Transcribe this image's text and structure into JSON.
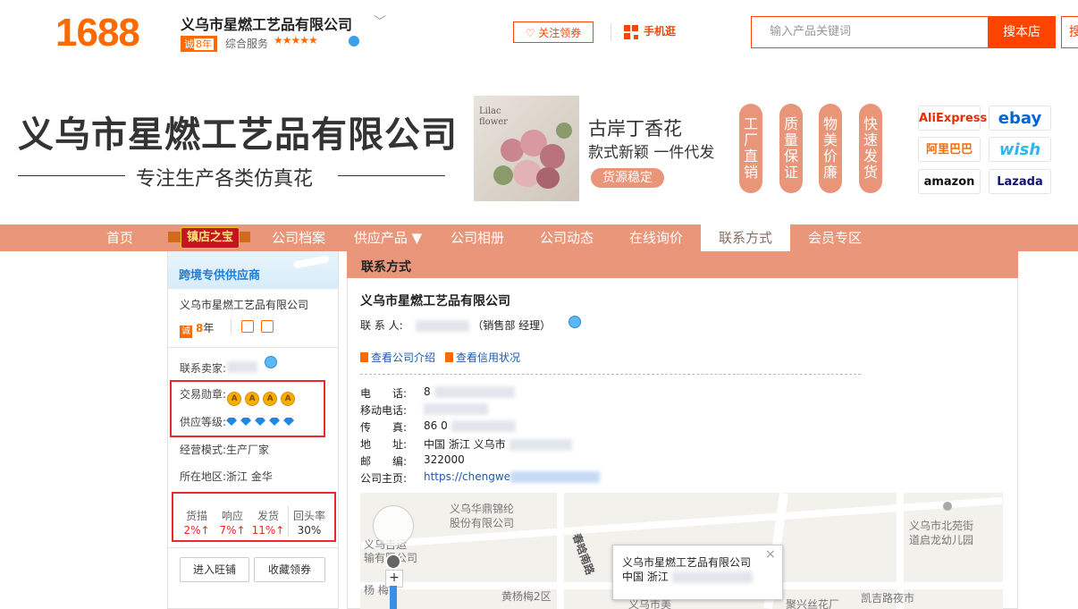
{
  "header": {
    "logo": "1688",
    "shop_name": "义乌市星燃工艺品有限公司",
    "year_badge_prefix": "诚",
    "year_badge_years": "8年",
    "service_label": "综合服务",
    "stars": "★★★★★",
    "follow_button": "关注领券",
    "mobile_label": "手机逛",
    "search_placeholder": "输入产品关键词",
    "search_button": "搜本店",
    "search_button_2": "搜"
  },
  "banner": {
    "company_name": "义乌市星燃工艺品有限公司",
    "slogan": "专注生产各类仿真花",
    "product_image_text": "Lilac flower",
    "product_title": "古岸丁香花",
    "product_subtitle": "款式新颖 一件代发",
    "product_tag": "货源稳定",
    "pills": [
      "工厂直销",
      "质量保证",
      "物美价廉",
      "快速发货"
    ],
    "platforms": [
      {
        "name": "AliExpress",
        "color": "#e62e04"
      },
      {
        "name": "ebay",
        "color": "#0064d2"
      },
      {
        "name": "阿里巴巴",
        "color": "#ff6a00"
      },
      {
        "name": "wish",
        "color": "#2fb7ec"
      },
      {
        "name": "amazon",
        "color": "#111111"
      },
      {
        "name": "Lazada",
        "color": "#0f136f"
      }
    ]
  },
  "nav": {
    "items": [
      "首页",
      "镇店之宝",
      "公司档案",
      "供应产品 ▼",
      "公司相册",
      "公司动态",
      "在线询价",
      "联系方式",
      "会员专区"
    ],
    "active": "联系方式"
  },
  "sidebar": {
    "header": "跨境专供供应商",
    "company": "义乌市星燃工艺品有限公司",
    "year_icon": "诚",
    "years_num": "8",
    "years_unit": "年",
    "contact_label": "联系卖家:",
    "medal_label": "交易勋章:",
    "medal_glyph": "A",
    "supply_label": "供应等级:",
    "business_mode": "经营模式:生产厂家",
    "region": "所在地区:浙江 金华",
    "stats": [
      {
        "label": "货描",
        "value": "2%↑"
      },
      {
        "label": "响应",
        "value": "7%↑"
      },
      {
        "label": "发货",
        "value": "11%↑"
      },
      {
        "label": "回头率",
        "value": "30%"
      }
    ],
    "btn_wangpu": "进入旺铺",
    "btn_favorite": "收藏领券"
  },
  "main": {
    "header": "联系方式",
    "company": "义乌市星燃工艺品有限公司",
    "contact_label": "联 系 人:",
    "contact_title": "（销售部 经理）",
    "link_intro": "查看公司介绍",
    "link_credit": "查看信用状况",
    "rows": [
      {
        "label": "电　　话:",
        "value": "8"
      },
      {
        "label": "移动电话:",
        "value": ""
      },
      {
        "label": "传　　真:",
        "value": "86 0"
      },
      {
        "label": "地　　址:",
        "value": "中国 浙江 义乌市"
      },
      {
        "label": "邮　　编:",
        "value": "322000"
      },
      {
        "label": "公司主页:",
        "value": "https://chengwe"
      }
    ],
    "map": {
      "labels": [
        "义乌华鼎锦纶",
        "股份有限公司",
        "义乌市北苑街",
        "道启龙幼儿园",
        "义乌吉运",
        "输有限公司",
        "春晗南路",
        "黄杨梅2区",
        "杨 梅",
        "凯吉路夜市",
        "义乌市美",
        "聚兴丝花厂"
      ],
      "popup_title": "义乌市星燃工艺品有限公司",
      "popup_addr": "中国 浙江",
      "popup_close": "×",
      "zoom_in": "+"
    }
  }
}
